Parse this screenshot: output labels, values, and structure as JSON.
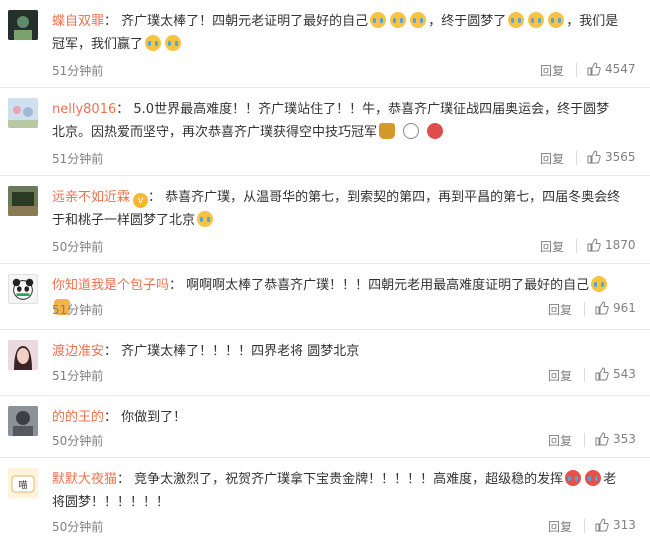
{
  "comments": [
    {
      "user": "蝶自双罪",
      "parts": [
        "：",
        "齐广璞太棒了！四朝元老证明了最好的自己",
        "，终于圆梦了",
        "，我们是冠军，我们赢了"
      ],
      "time": "51分钟前",
      "reply": "回复",
      "likes": "4547"
    },
    {
      "user": "nelly8016",
      "parts": [
        "：",
        "5.0世界最高难度！！齐广璞站住了！！牛，恭喜齐广璞征战四届奥运会，终于圆梦北京。因热爱而坚守，再次恭喜齐广璞获得空中技巧冠军"
      ],
      "time": "51分钟前",
      "reply": "回复",
      "likes": "3565"
    },
    {
      "user": "远亲不如近霖",
      "parts": [
        "：",
        "恭喜齐广璞，从温哥华的第七，到索契的第四，再到平昌的第七，四届冬奥会终于和桃子一样圆梦了北京"
      ],
      "time": "50分钟前",
      "reply": "回复",
      "likes": "1870"
    },
    {
      "user": "你知道我是个包子吗",
      "parts": [
        "：",
        "啊啊啊太棒了恭喜齐广璞！！！四朝元老用最高难度证明了最好的自己"
      ],
      "time": "51分钟前",
      "reply": "回复",
      "likes": "961"
    },
    {
      "user": "渡边准安",
      "parts": [
        "：",
        "齐广璞太棒了！！！！四界老将 圆梦北京"
      ],
      "time": "51分钟前",
      "reply": "回复",
      "likes": "543"
    },
    {
      "user": "的的王的",
      "parts": [
        "：",
        "你做到了！"
      ],
      "time": "50分钟前",
      "reply": "回复",
      "likes": "353"
    },
    {
      "user": "默默大夜猫",
      "parts": [
        "：",
        "竞争太激烈了，祝贺齐广璞拿下宝贵金牌！！！！！高难度，超级稳的发挥",
        "老将圆梦！！！！！！"
      ],
      "time": "50分钟前",
      "reply": "回复",
      "likes": "313"
    }
  ],
  "icons": {
    "emoji_cry": "tear-emoji",
    "emoji_trophy": "trophy-emoji",
    "emoji_panda": "panda-emoji",
    "emoji_mushroom": "mushroom-emoji",
    "emoji_thumb": "thumbs-up-emoji",
    "emoji_cheer": "cheering-emoji",
    "like": "thumbs-up-icon",
    "vip": "vip-badge-icon"
  },
  "colors": {
    "username": "#eb7350",
    "meta": "#808080",
    "text": "#333333"
  }
}
